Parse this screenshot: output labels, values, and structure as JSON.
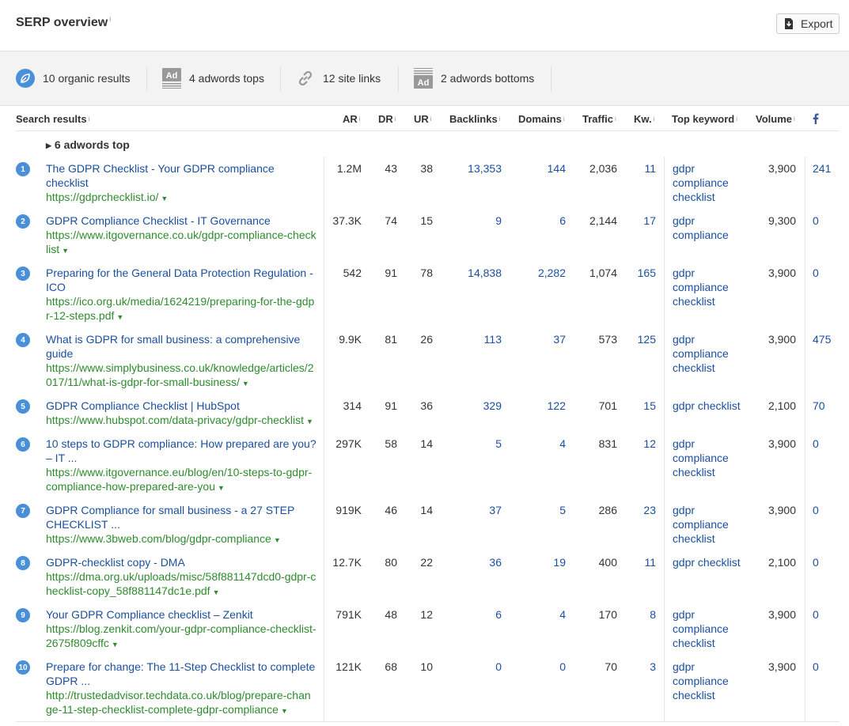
{
  "page": {
    "title": "SERP overview",
    "info_marker": "i",
    "export_label": "Export"
  },
  "stats": [
    {
      "icon": "leaf-icon",
      "label": "10 organic results"
    },
    {
      "icon": "ad-icon",
      "label": "4 adwords tops"
    },
    {
      "icon": "link-icon",
      "label": "12 site links"
    },
    {
      "icon": "ad-bottom-icon",
      "label": "2 adwords bottoms"
    }
  ],
  "columns": {
    "search_results": "Search results",
    "ar": "AR",
    "dr": "DR",
    "ur": "UR",
    "backlinks": "Backlinks",
    "domains": "Domains",
    "traffic": "Traffic",
    "kw": "Kw.",
    "top_keyword": "Top keyword",
    "volume": "Volume",
    "facebook_icon": "facebook-icon"
  },
  "adwords_toggle": "6 adwords top",
  "rows": [
    {
      "pos": "1",
      "title": "The GDPR Checklist - Your GDPR compliance checklist",
      "url": "https://gdprchecklist.io/",
      "ar": "1.2M",
      "dr": "43",
      "ur": "38",
      "backlinks": "13,353",
      "domains": "144",
      "traffic": "2,036",
      "kw": "11",
      "top_keyword": "gdpr compliance checklist",
      "volume": "3,900",
      "fb": "241"
    },
    {
      "pos": "2",
      "title": "GDPR Compliance Checklist - IT Governance",
      "url": "https://www.itgovernance.co.uk/gdpr-compliance-checklist",
      "ar": "37.3K",
      "dr": "74",
      "ur": "15",
      "backlinks": "9",
      "domains": "6",
      "traffic": "2,144",
      "kw": "17",
      "top_keyword": "gdpr compliance",
      "volume": "9,300",
      "fb": "0"
    },
    {
      "pos": "3",
      "title": "Preparing for the General Data Protection Regulation - ICO",
      "url": "https://ico.org.uk/media/1624219/preparing-for-the-gdpr-12-steps.pdf",
      "ar": "542",
      "dr": "91",
      "ur": "78",
      "backlinks": "14,838",
      "domains": "2,282",
      "traffic": "1,074",
      "kw": "165",
      "top_keyword": "gdpr compliance checklist",
      "volume": "3,900",
      "fb": "0"
    },
    {
      "pos": "4",
      "title": "What is GDPR for small business: a comprehensive guide",
      "url": "https://www.simplybusiness.co.uk/knowledge/articles/2017/11/what-is-gdpr-for-small-business/",
      "ar": "9.9K",
      "dr": "81",
      "ur": "26",
      "backlinks": "113",
      "domains": "37",
      "traffic": "573",
      "kw": "125",
      "top_keyword": "gdpr compliance checklist",
      "volume": "3,900",
      "fb": "475"
    },
    {
      "pos": "5",
      "title": "GDPR Compliance Checklist | HubSpot",
      "url": "https://www.hubspot.com/data-privacy/gdpr-checklist",
      "ar": "314",
      "dr": "91",
      "ur": "36",
      "backlinks": "329",
      "domains": "122",
      "traffic": "701",
      "kw": "15",
      "top_keyword": "gdpr checklist",
      "volume": "2,100",
      "fb": "70"
    },
    {
      "pos": "6",
      "title": "10 steps to GDPR compliance: How prepared are you? – IT ...",
      "url": "https://www.itgovernance.eu/blog/en/10-steps-to-gdpr-compliance-how-prepared-are-you",
      "ar": "297K",
      "dr": "58",
      "ur": "14",
      "backlinks": "5",
      "domains": "4",
      "traffic": "831",
      "kw": "12",
      "top_keyword": "gdpr compliance checklist",
      "volume": "3,900",
      "fb": "0"
    },
    {
      "pos": "7",
      "title": "GDPR Compliance for small business - a 27 STEP CHECKLIST ...",
      "url": "https://www.3bweb.com/blog/gdpr-compliance",
      "ar": "919K",
      "dr": "46",
      "ur": "14",
      "backlinks": "37",
      "domains": "5",
      "traffic": "286",
      "kw": "23",
      "top_keyword": "gdpr compliance checklist",
      "volume": "3,900",
      "fb": "0"
    },
    {
      "pos": "8",
      "title": "GDPR-checklist copy - DMA",
      "url": "https://dma.org.uk/uploads/misc/58f881147dcd0-gdpr-checklist-copy_58f881147dc1e.pdf",
      "ar": "12.7K",
      "dr": "80",
      "ur": "22",
      "backlinks": "36",
      "domains": "19",
      "traffic": "400",
      "kw": "11",
      "top_keyword": "gdpr checklist",
      "volume": "2,100",
      "fb": "0"
    },
    {
      "pos": "9",
      "title": "Your GDPR Compliance checklist – Zenkit",
      "url": "https://blog.zenkit.com/your-gdpr-compliance-checklist-2675f809cffc",
      "ar": "791K",
      "dr": "48",
      "ur": "12",
      "backlinks": "6",
      "domains": "4",
      "traffic": "170",
      "kw": "8",
      "top_keyword": "gdpr compliance checklist",
      "volume": "3,900",
      "fb": "0"
    },
    {
      "pos": "10",
      "title": "Prepare for change: The 11-Step Checklist to complete GDPR ...",
      "url": "http://trustedadvisor.techdata.co.uk/blog/prepare-change-11-step-checklist-complete-gdpr-compliance",
      "ar": "121K",
      "dr": "68",
      "ur": "10",
      "backlinks": "0",
      "domains": "0",
      "traffic": "70",
      "kw": "3",
      "top_keyword": "gdpr compliance checklist",
      "volume": "3,900",
      "fb": "0"
    }
  ]
}
